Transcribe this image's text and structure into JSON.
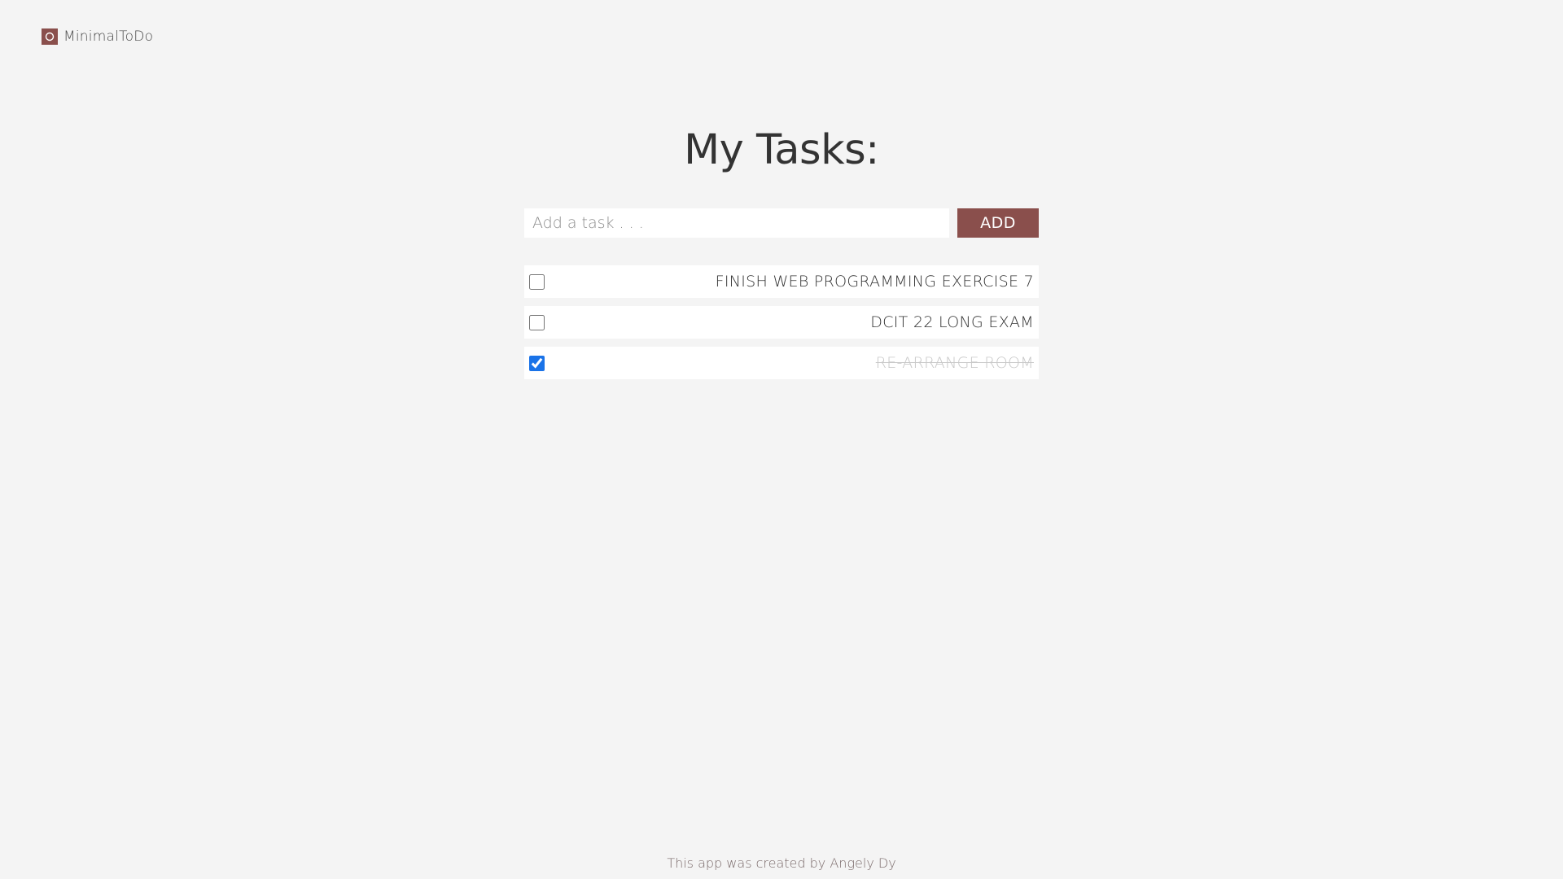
{
  "brand": {
    "name": "MinimalToDo",
    "logo_icon": "circle-icon",
    "color": "#8a4f4c"
  },
  "main": {
    "title": "My Tasks:",
    "input": {
      "placeholder": "Add a task . . .",
      "value": ""
    },
    "add_label": "ADD",
    "accent_color": "#8a4f4c"
  },
  "tasks": [
    {
      "text": "FINISH WEB PROGRAMMING EXERCISE 7",
      "done": false
    },
    {
      "text": "DCIT 22 LONG EXAM",
      "done": false
    },
    {
      "text": "RE-ARRANGE ROOM",
      "done": true
    }
  ],
  "footer": {
    "text": "This app was created by Angely Dy"
  }
}
